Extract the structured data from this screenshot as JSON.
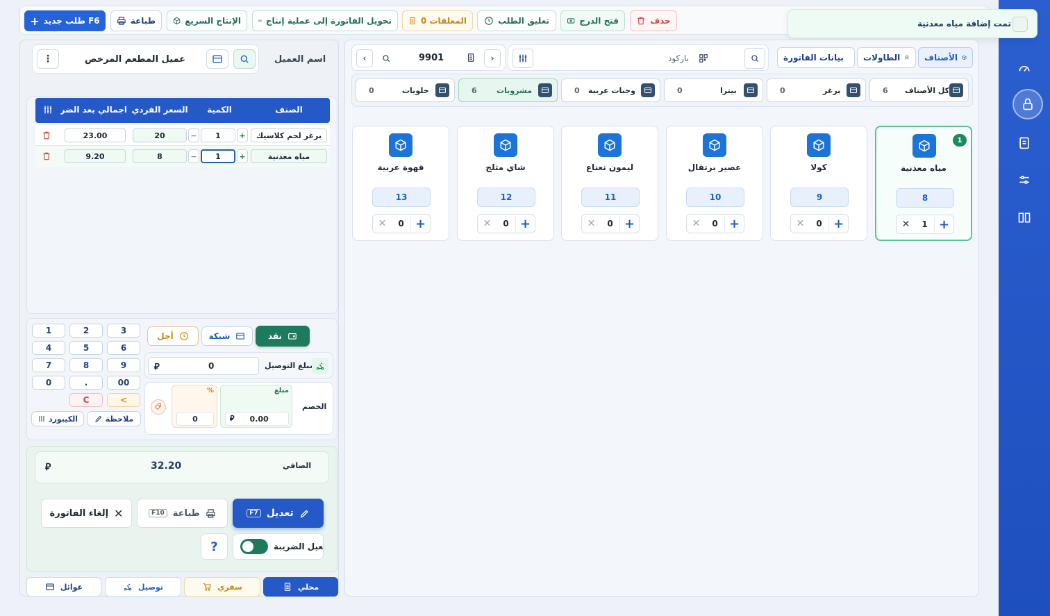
{
  "toolbar": {
    "new_order": "طلب جديد F6",
    "print": "طباعة",
    "quick_production": "الإنتاج السريع",
    "convert_invoice": "تحويل الفاتورة إلى عملية إنتاج",
    "held_label": "المعلقات 0",
    "hold_order": "تعليق الطلب",
    "open_drawer": "فتح الدرج",
    "delete": "حذف"
  },
  "toast": {
    "message": "تمت إضافة مياه معدنية"
  },
  "customer": {
    "label": "اسم العميل",
    "value": "عميل المطعم المرخص"
  },
  "order_table": {
    "headers": {
      "item": "الصنف",
      "qty": "الكمية",
      "unit_price": "السعر الفردي",
      "total": "اجمالي بعد الضريبة"
    },
    "rows": [
      {
        "item": "برغر لحم كلاسيك",
        "qty": "1",
        "unit_price": "20",
        "total": "23.00"
      },
      {
        "item": "مياه معدنية",
        "qty": "1",
        "unit_price": "8",
        "total": "9.20"
      }
    ]
  },
  "payment": {
    "cash": "نقد",
    "network": "شبكة",
    "deferred": "أجل",
    "delivery_label": "مبلغ التوصيل",
    "delivery_value": "0",
    "discount_label": "الخصم",
    "discount_amount_label": "مبلغ",
    "discount_amount": "0.00",
    "discount_percent_label": "%",
    "discount_percent": "0"
  },
  "keypad": {
    "keys": [
      "3",
      "2",
      "1",
      "6",
      "5",
      "4",
      "9",
      "8",
      "7",
      "00",
      ".",
      "0"
    ],
    "back": "<",
    "clear": "C",
    "note": "ملاحظة",
    "keyboard": "الكيبورد"
  },
  "summary": {
    "net_label": "الصافي",
    "net_value": "32.20"
  },
  "actions": {
    "edit": "تعديل",
    "edit_key": "F7",
    "print": "طباعة",
    "print_key": "F10",
    "cancel": "إلغاء الفاتورة",
    "tax_toggle": "تفعيل الضريبة",
    "help": "?"
  },
  "order_types": {
    "local": "محلي",
    "takeaway": "سفري",
    "delivery": "توصيل",
    "families": "عوائل"
  },
  "catalog": {
    "tabs": {
      "categories": "الأصناف",
      "tables": "الطاولات",
      "invoice_data": "بيانات الفاتورة"
    },
    "barcode_placeholder": "باركود",
    "invoice_number": "9901",
    "categories": [
      {
        "name": "كل الأصناف",
        "count": "6"
      },
      {
        "name": "برغر",
        "count": "0"
      },
      {
        "name": "بيتزا",
        "count": "0"
      },
      {
        "name": "وجبات عربية",
        "count": "0"
      },
      {
        "name": "مشروبات",
        "count": "6"
      },
      {
        "name": "حلويات",
        "count": "0"
      }
    ],
    "products": [
      {
        "name": "مياه معدنية",
        "price": "8",
        "qty": "1",
        "badge": "1"
      },
      {
        "name": "كولا",
        "price": "9",
        "qty": "0"
      },
      {
        "name": "عصير برتقال",
        "price": "10",
        "qty": "0"
      },
      {
        "name": "ليمون نعناع",
        "price": "11",
        "qty": "0"
      },
      {
        "name": "شاي مثلج",
        "price": "12",
        "qty": "0"
      },
      {
        "name": "قهوة عربية",
        "price": "13",
        "qty": "0"
      }
    ]
  },
  "colors": {
    "primary": "#1f4fbf",
    "accent_green": "#1d7a5c",
    "danger": "#d94343",
    "warning": "#c88a12"
  }
}
